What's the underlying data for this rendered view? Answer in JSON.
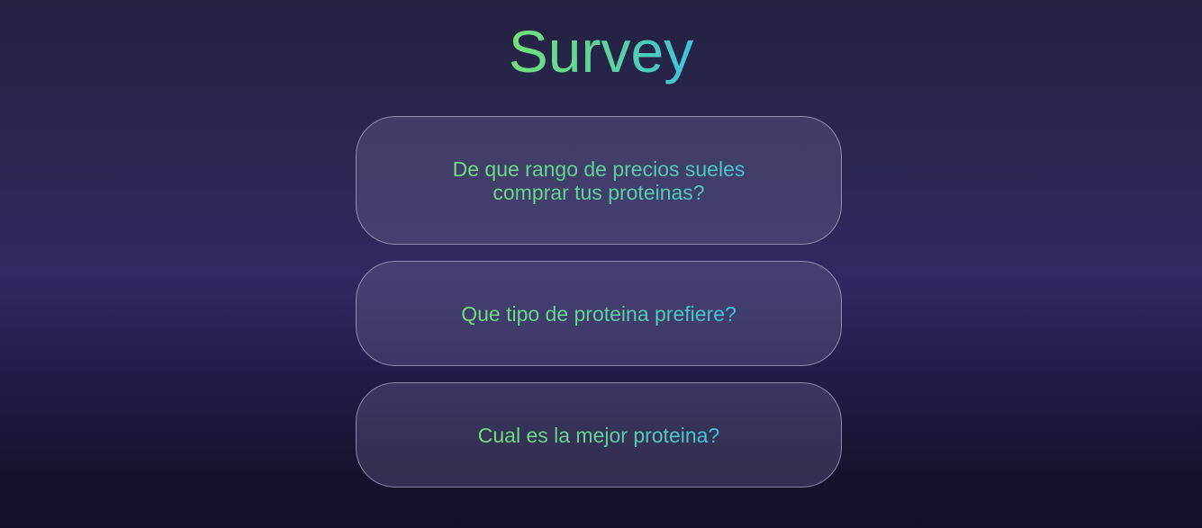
{
  "page": {
    "title": "Survey"
  },
  "questions": [
    {
      "text": "De que rango de precios sueles comprar tus proteinas?"
    },
    {
      "text": "Que tipo de proteina prefiere?"
    },
    {
      "text": "Cual es la mejor proteina?"
    }
  ],
  "colors": {
    "gradient_start": "#73e07a",
    "gradient_end": "#3ec2de",
    "background_top": "#232240",
    "background_mid": "#2f2a62",
    "background_bottom": "#120f28"
  }
}
